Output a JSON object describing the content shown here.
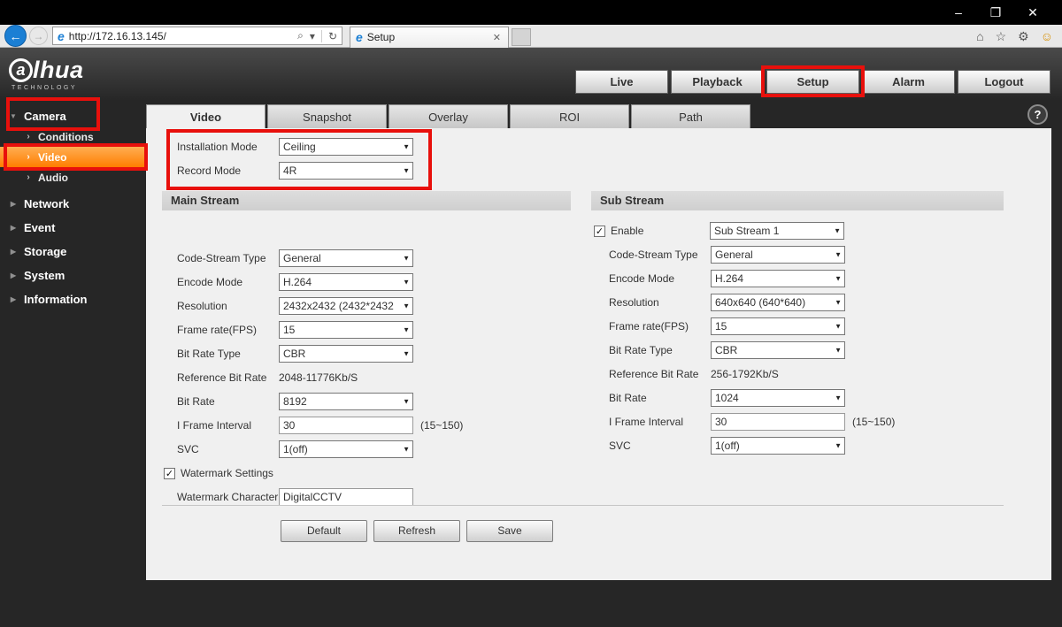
{
  "colors": {
    "annotation": "#e8100c",
    "selected_item": "#ff7d00"
  },
  "icons": {
    "minimize": "–",
    "restore": "❐",
    "close": "✕",
    "back": "←",
    "forward": "→",
    "ie": "e",
    "search": "⌕",
    "dropdown": "▾",
    "refresh": "↻",
    "tab_close": "✕",
    "home": "⌂",
    "favorites": "☆",
    "settings": "⚙",
    "smiley": "☺",
    "help": "?",
    "expanded": "▼",
    "collapsed": "▶",
    "sub_arrow": "›"
  },
  "browser": {
    "url": "http://172.16.13.145/",
    "tab_title": "Setup"
  },
  "header": {
    "logo_a": "a",
    "logo_rest": "lhua",
    "logo_sub": "TECHNOLOGY",
    "nav": [
      {
        "label": "Live"
      },
      {
        "label": "Playback"
      },
      {
        "label": "Setup"
      },
      {
        "label": "Alarm"
      },
      {
        "label": "Logout"
      }
    ]
  },
  "sidebar": {
    "camera": {
      "label": "Camera"
    },
    "camera_children": [
      {
        "label": "Conditions"
      },
      {
        "label": "Video"
      },
      {
        "label": "Audio"
      }
    ],
    "items": [
      {
        "label": "Network"
      },
      {
        "label": "Event"
      },
      {
        "label": "Storage"
      },
      {
        "label": "System"
      },
      {
        "label": "Information"
      }
    ]
  },
  "tabs": [
    {
      "label": "Video"
    },
    {
      "label": "Snapshot"
    },
    {
      "label": "Overlay"
    },
    {
      "label": "ROI"
    },
    {
      "label": "Path"
    }
  ],
  "form": {
    "installation_mode": {
      "label": "Installation Mode",
      "value": "Ceiling"
    },
    "record_mode": {
      "label": "Record Mode",
      "value": "4R"
    },
    "main_stream": {
      "title": "Main Stream",
      "rows": [
        {
          "label": "Code-Stream Type",
          "value": "General"
        },
        {
          "label": "Encode Mode",
          "value": "H.264"
        },
        {
          "label": "Resolution",
          "value": "2432x2432 (2432*2432"
        },
        {
          "label": "Frame rate(FPS)",
          "value": "15"
        },
        {
          "label": "Bit Rate Type",
          "value": "CBR"
        },
        {
          "label": "Reference Bit Rate",
          "value": "2048-11776Kb/S"
        },
        {
          "label": "Bit Rate",
          "value": "8192"
        },
        {
          "label": "I Frame Interval",
          "value": "30",
          "suffix": "(15~150)"
        },
        {
          "label": "SVC",
          "value": "1(off)"
        }
      ],
      "watermark": {
        "label": "Watermark Settings",
        "checked": true
      },
      "watermark_character": {
        "label": "Watermark Character",
        "value": "DigitalCCTV"
      }
    },
    "sub_stream": {
      "title": "Sub Stream",
      "enable": {
        "label": "Enable",
        "checked": true,
        "value": "Sub Stream 1"
      },
      "rows": [
        {
          "label": "Code-Stream Type",
          "value": "General"
        },
        {
          "label": "Encode Mode",
          "value": "H.264"
        },
        {
          "label": "Resolution",
          "value": "640x640 (640*640)"
        },
        {
          "label": "Frame rate(FPS)",
          "value": "15"
        },
        {
          "label": "Bit Rate Type",
          "value": "CBR"
        },
        {
          "label": "Reference Bit Rate",
          "value": "256-1792Kb/S"
        },
        {
          "label": "Bit Rate",
          "value": "1024"
        },
        {
          "label": "I Frame Interval",
          "value": "30",
          "suffix": "(15~150)"
        },
        {
          "label": "SVC",
          "value": "1(off)"
        }
      ]
    },
    "buttons": [
      {
        "label": "Default"
      },
      {
        "label": "Refresh"
      },
      {
        "label": "Save"
      }
    ]
  }
}
